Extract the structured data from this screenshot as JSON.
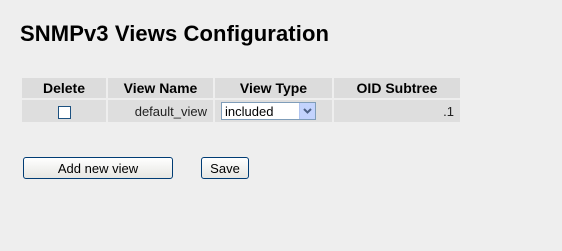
{
  "page": {
    "title": "SNMPv3 Views Configuration"
  },
  "table": {
    "headers": {
      "delete": "Delete",
      "view_name": "View Name",
      "view_type": "View Type",
      "oid_subtree": "OID Subtree"
    },
    "rows": [
      {
        "delete_checked": false,
        "view_name": "default_view",
        "view_type": "included",
        "oid_subtree": ".1"
      }
    ]
  },
  "buttons": {
    "add_new_view": "Add new view",
    "save": "Save"
  },
  "colors": {
    "background": "#eeeeee",
    "header_bg": "#dcdcdc",
    "cell_bg": "#dedede",
    "select_arrow_bg": "#c3d3fd",
    "button_border": "#003c74"
  },
  "icons": {
    "select_arrow": "chevron-down-icon"
  }
}
